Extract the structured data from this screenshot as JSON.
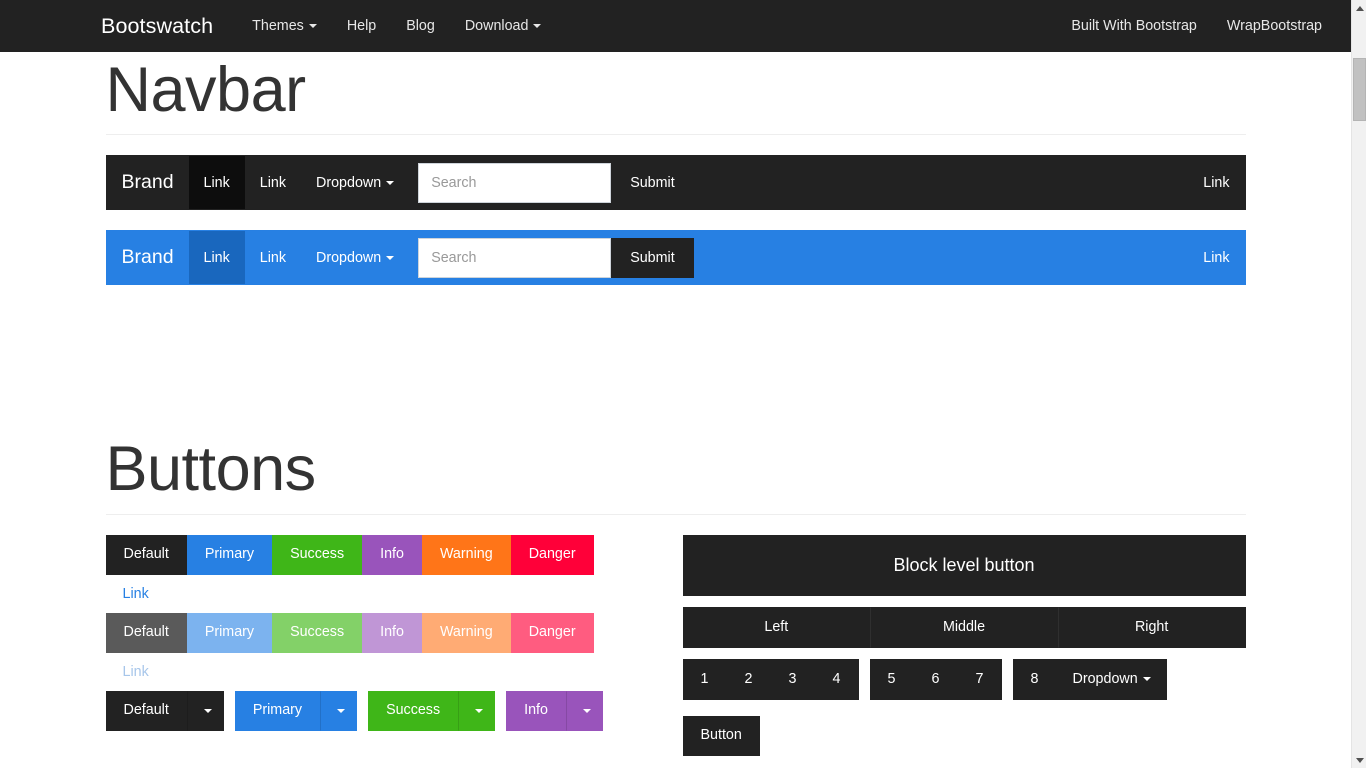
{
  "topbar": {
    "brand": "Bootswatch",
    "left_items": [
      {
        "label": "Themes",
        "has_caret": true
      },
      {
        "label": "Help",
        "has_caret": false
      },
      {
        "label": "Blog",
        "has_caret": false
      },
      {
        "label": "Download",
        "has_caret": true
      }
    ],
    "right_items": [
      {
        "label": "Built With Bootstrap"
      },
      {
        "label": "WrapBootstrap"
      }
    ],
    "background": "#222222"
  },
  "navbar_section": {
    "title": "Navbar",
    "demos": [
      {
        "variant": "dark",
        "background": "#222222",
        "brand": "Brand",
        "links": [
          {
            "label": "Link",
            "active": true
          },
          {
            "label": "Link",
            "active": false
          }
        ],
        "dropdown": "Dropdown",
        "search_placeholder": "Search",
        "search_value": "",
        "submit": "Submit",
        "right_link": "Link"
      },
      {
        "variant": "primary",
        "background": "#2780e3",
        "brand": "Brand",
        "links": [
          {
            "label": "Link",
            "active": true
          },
          {
            "label": "Link",
            "active": false
          }
        ],
        "dropdown": "Dropdown",
        "search_placeholder": "Search",
        "search_value": "",
        "submit": "Submit",
        "right_link": "Link"
      }
    ]
  },
  "buttons_section": {
    "title": "Buttons",
    "row_normal": [
      {
        "label": "Default",
        "variant": "default",
        "color": "#222222"
      },
      {
        "label": "Primary",
        "variant": "primary",
        "color": "#2780e3"
      },
      {
        "label": "Success",
        "variant": "success",
        "color": "#3fb618"
      },
      {
        "label": "Info",
        "variant": "info",
        "color": "#9954bb"
      },
      {
        "label": "Warning",
        "variant": "warning",
        "color": "#ff7518"
      },
      {
        "label": "Danger",
        "variant": "danger",
        "color": "#ff0039"
      }
    ],
    "link_normal": "Link",
    "row_disabled": [
      {
        "label": "Default",
        "variant": "default",
        "color": "#5a5a5a"
      },
      {
        "label": "Primary",
        "variant": "primary",
        "color": "#7cb3ef"
      },
      {
        "label": "Success",
        "variant": "success",
        "color": "#83d168"
      },
      {
        "label": "Info",
        "variant": "info",
        "color": "#c096d6"
      },
      {
        "label": "Warning",
        "variant": "warning",
        "color": "#ffab74"
      },
      {
        "label": "Danger",
        "variant": "danger",
        "color": "#ff5c80"
      }
    ],
    "link_disabled": "Link",
    "row_split_dropdowns": [
      {
        "label": "Default",
        "variant": "default"
      },
      {
        "label": "Primary",
        "variant": "primary"
      },
      {
        "label": "Success",
        "variant": "success"
      },
      {
        "label": "Info",
        "variant": "info"
      }
    ],
    "block_button": "Block level button",
    "justified_group": [
      "Left",
      "Middle",
      "Right"
    ],
    "num_group_1": [
      "1",
      "2",
      "3",
      "4"
    ],
    "num_group_2": [
      "5",
      "6",
      "7"
    ],
    "num_group_3": [
      "8"
    ],
    "num_group_dropdown": "Dropdown",
    "lone_button": "Button"
  },
  "icons": {
    "caret": "caret-down-icon",
    "scroll_up": "scroll-up-arrow-icon",
    "scroll_down": "scroll-down-arrow-icon"
  }
}
